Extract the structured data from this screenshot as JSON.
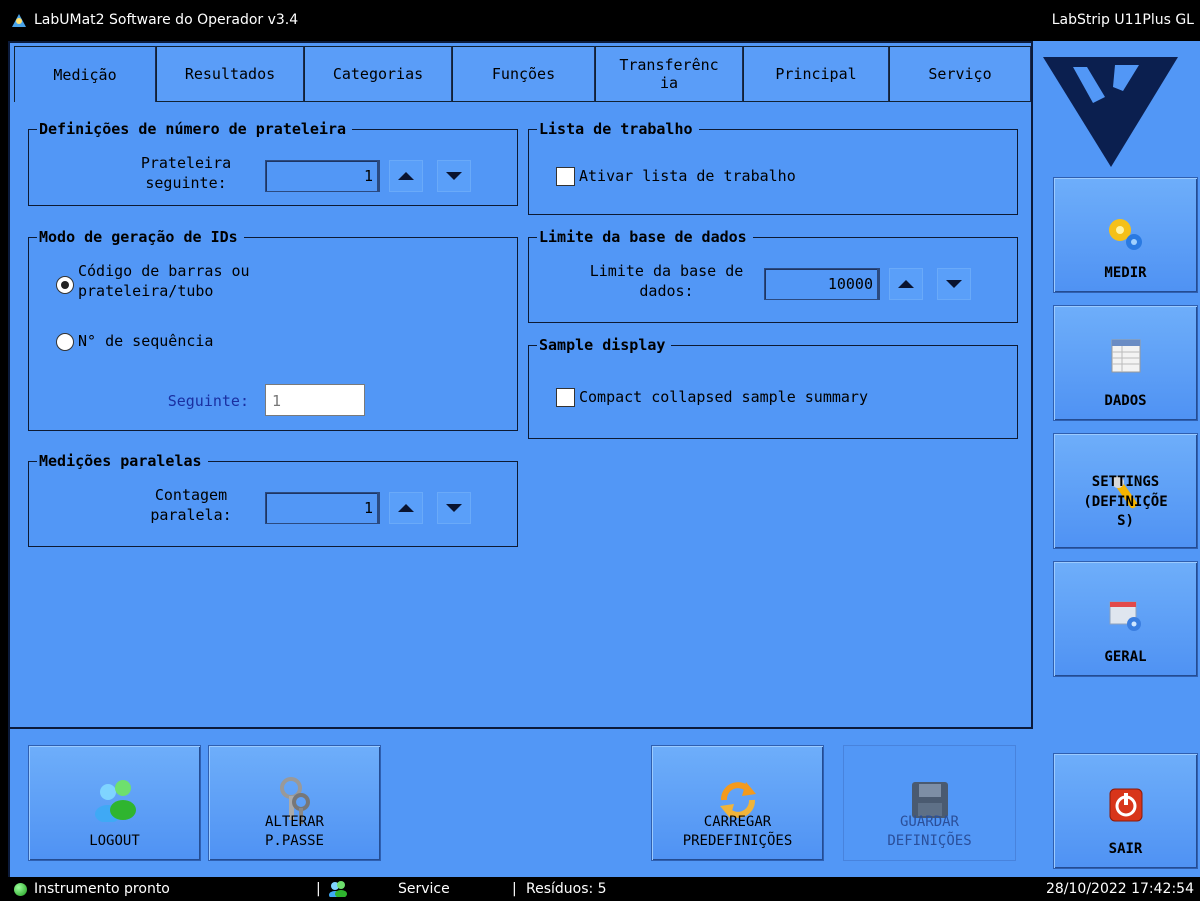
{
  "window": {
    "title": "LabUMat2 Software do Operador v3.4",
    "right_title": "LabStrip U11Plus GL"
  },
  "tabs": [
    {
      "label": "Medição",
      "active": true
    },
    {
      "label": "Resultados"
    },
    {
      "label": "Categorias"
    },
    {
      "label": "Funções"
    },
    {
      "label": "Transferênc ia"
    },
    {
      "label": "Principal"
    },
    {
      "label": "Serviço"
    }
  ],
  "shelf_group": {
    "title": "Definições de número de prateleira",
    "next_label": "Prateleira seguinte:",
    "next_value": "1"
  },
  "id_group": {
    "title": "Modo de geração de IDs",
    "option_barcode": "Código de barras ou prateleira/tubo",
    "option_sequence": "N° de sequência",
    "selected": "barcode",
    "next_label": "Seguinte:",
    "next_value": "1"
  },
  "parallel_group": {
    "title": "Medições paralelas",
    "count_label": "Contagem paralela:",
    "count_value": "1"
  },
  "worklist_group": {
    "title": "Lista de trabalho",
    "enable_label": "Ativar lista de trabalho",
    "enabled": false
  },
  "db_group": {
    "title": "Limite da base de dados",
    "limit_label": "Limite da base de dados:",
    "limit_value": "10000"
  },
  "sample_group": {
    "title": "Sample display",
    "compact_label": "Compact collapsed sample summary",
    "checked": false
  },
  "bottom_buttons": {
    "logout": "LOGOUT",
    "change_pw_line1": "ALTERAR",
    "change_pw_line2": "P.PASSE",
    "load_line1": "CARREGAR",
    "load_line2": "PREDEFINIÇÕES",
    "save_line1": "GUARDAR",
    "save_line2": "DEFINIÇÕES"
  },
  "side_buttons": {
    "measure": "MEDIR",
    "data": "DADOS",
    "settings_line1": "SETTINGS",
    "settings_line2": "(DEFINIÇÕE",
    "settings_line3": "S)",
    "general": "GERAL",
    "exit": "SAIR"
  },
  "status": {
    "state": "Instrumento pronto",
    "user": "Service",
    "residues": "Resíduos: 5",
    "datetime": "28/10/2022 17:42:54"
  }
}
